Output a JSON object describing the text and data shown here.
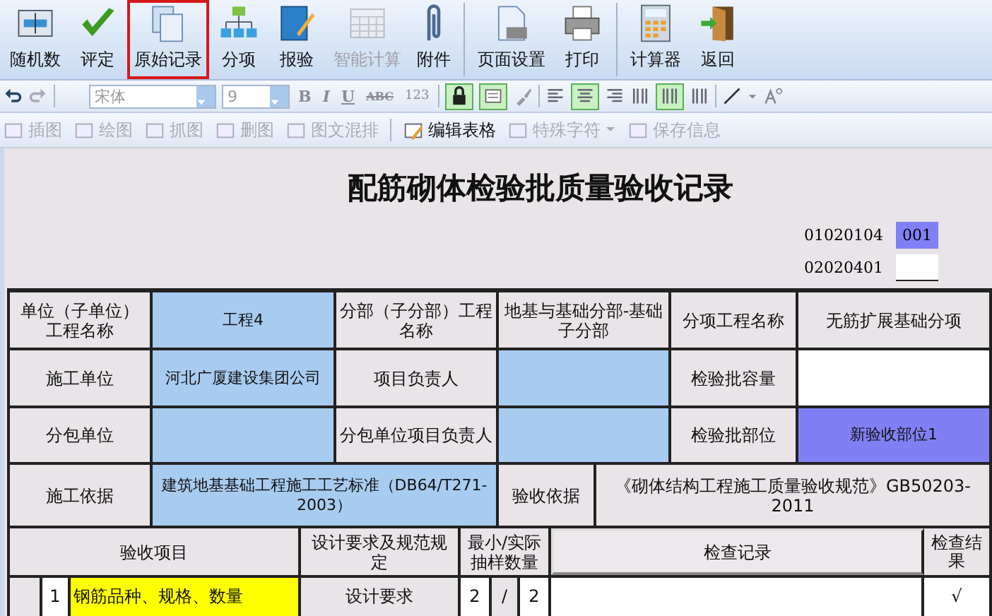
{
  "toolbar": [
    {
      "label": "随机数",
      "selected": false,
      "disabled": false
    },
    {
      "label": "评定",
      "selected": false,
      "disabled": false
    },
    {
      "label": "原始记录",
      "selected": true,
      "disabled": false
    },
    {
      "label": "分项",
      "selected": false,
      "disabled": false
    },
    {
      "label": "报验",
      "selected": false,
      "disabled": false
    },
    {
      "label": "智能计算",
      "selected": false,
      "disabled": true
    },
    {
      "label": "附件",
      "selected": false,
      "disabled": false
    },
    {
      "label": "页面设置",
      "selected": false,
      "disabled": false
    },
    {
      "label": "打印",
      "selected": false,
      "disabled": false
    },
    {
      "label": "计算器",
      "selected": false,
      "disabled": false
    },
    {
      "label": "返回",
      "selected": false,
      "disabled": false
    }
  ],
  "format_bar": {
    "font": "宋体",
    "size": "9",
    "bold": "B",
    "italic": "I",
    "underline": "U",
    "strike": "ABC",
    "numbers": "123",
    "locked": true
  },
  "insert_bar": [
    {
      "label": "插图",
      "disabled": true
    },
    {
      "label": "绘图",
      "disabled": true
    },
    {
      "label": "抓图",
      "disabled": true
    },
    {
      "label": "删图",
      "disabled": true
    },
    {
      "label": "图文混排",
      "disabled": true
    },
    {
      "label": "编辑表格",
      "disabled": false
    },
    {
      "label": "特殊字符",
      "disabled": true
    },
    {
      "label": "保存信息",
      "disabled": true
    }
  ],
  "document": {
    "title": "配筋砌体检验批质量验收记录",
    "codes": [
      {
        "code": "01020104",
        "value": "001",
        "kind": "highlight"
      },
      {
        "code": "02020401",
        "kind": "blank"
      }
    ],
    "rows": [
      [
        {
          "text": "单位（子单位）工程名称",
          "kind": "label"
        },
        {
          "text": "工程4",
          "kind": "input"
        },
        {
          "text": "分部（子分部）工程名称",
          "kind": "label"
        },
        {
          "text": "地基与基础分部-基础子分部",
          "kind": "label"
        },
        {
          "text": "分项工程名称",
          "kind": "label"
        },
        {
          "text": "无筋扩展基础分项",
          "kind": "label"
        }
      ],
      [
        {
          "text": "施工单位",
          "kind": "label"
        },
        {
          "text": "河北广厦建设集团公司",
          "kind": "input"
        },
        {
          "text": "项目负责人",
          "kind": "label"
        },
        {
          "text": "",
          "kind": "input"
        },
        {
          "text": "检验批容量",
          "kind": "label"
        },
        {
          "text": "",
          "kind": "blank"
        }
      ],
      [
        {
          "text": "分包单位",
          "kind": "label"
        },
        {
          "text": "",
          "kind": "input"
        },
        {
          "text": "分包单位项目负责人",
          "kind": "label"
        },
        {
          "text": "",
          "kind": "input"
        },
        {
          "text": "检验批部位",
          "kind": "label"
        },
        {
          "text": "新验收部位1",
          "kind": "highlight"
        }
      ],
      [
        {
          "text": "施工依据",
          "kind": "label"
        },
        {
          "text": "建筑地基基础工程施工工艺标准（DB64/T271-2003）",
          "kind": "input"
        },
        {
          "text": "验收依据",
          "kind": "label"
        },
        {
          "text": "《砌体结构工程施工质量验收规范》GB50203-2011",
          "kind": "label"
        }
      ],
      [
        {
          "text": "验收项目",
          "kind": "label"
        },
        {
          "text": "设计要求及规范规定",
          "kind": "label"
        },
        {
          "text": "最小/实际抽样数量",
          "kind": "label"
        },
        {
          "text": "检查记录",
          "kind": "raised"
        },
        {
          "text": "检查结果",
          "kind": "label"
        }
      ]
    ],
    "items": [
      {
        "number": "1",
        "item": "钢筋品种、规格、数量",
        "requirement": "设计要求",
        "minimum": "2",
        "separator": "/",
        "actual": "2",
        "result": "√"
      }
    ]
  }
}
